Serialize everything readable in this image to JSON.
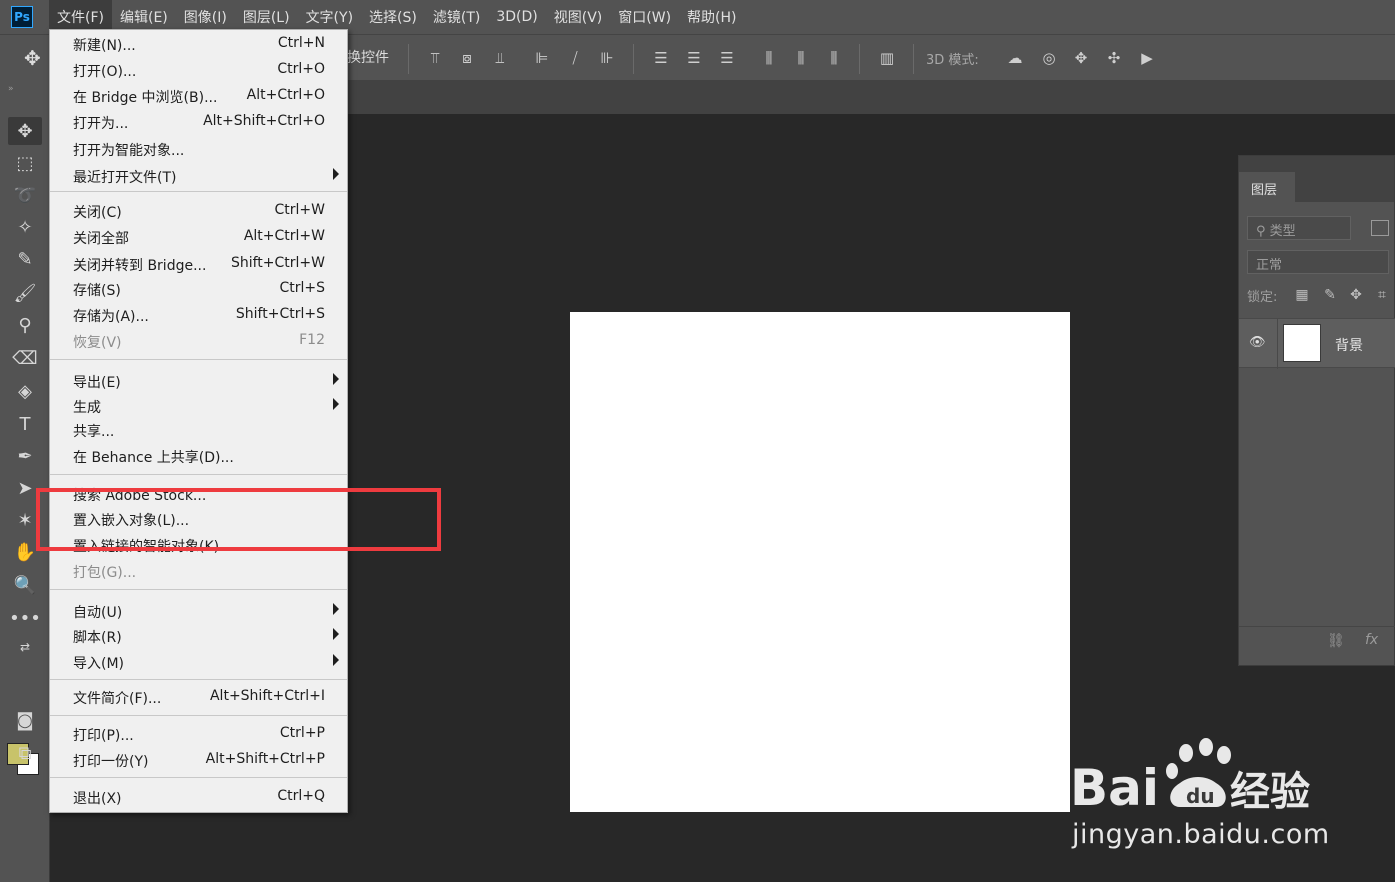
{
  "app": {
    "logo": "Ps"
  },
  "menubar": {
    "items": [
      {
        "label": "文件(F)"
      },
      {
        "label": "编辑(E)"
      },
      {
        "label": "图像(I)"
      },
      {
        "label": "图层(L)"
      },
      {
        "label": "文字(Y)"
      },
      {
        "label": "选择(S)"
      },
      {
        "label": "滤镜(T)"
      },
      {
        "label": "3D(D)"
      },
      {
        "label": "视图(V)"
      },
      {
        "label": "窗口(W)"
      },
      {
        "label": "帮助(H)"
      }
    ]
  },
  "optionsbar": {
    "label_tail": "换控件",
    "mode_3d_label": "3D 模式:"
  },
  "file_menu": {
    "items": [
      {
        "label": "新建(N)...",
        "shortcut": "Ctrl+N"
      },
      {
        "label": "打开(O)...",
        "shortcut": "Ctrl+O"
      },
      {
        "label": "在 Bridge 中浏览(B)...",
        "shortcut": "Alt+Ctrl+O"
      },
      {
        "label": "打开为...",
        "shortcut": "Alt+Shift+Ctrl+O"
      },
      {
        "label": "打开为智能对象...",
        "shortcut": ""
      },
      {
        "label": "最近打开文件(T)",
        "shortcut": ""
      },
      {
        "label": "关闭(C)",
        "shortcut": "Ctrl+W"
      },
      {
        "label": "关闭全部",
        "shortcut": "Alt+Ctrl+W"
      },
      {
        "label": "关闭并转到 Bridge...",
        "shortcut": "Shift+Ctrl+W"
      },
      {
        "label": "存储(S)",
        "shortcut": "Ctrl+S"
      },
      {
        "label": "存储为(A)...",
        "shortcut": "Shift+Ctrl+S"
      },
      {
        "label": "恢复(V)",
        "shortcut": "F12"
      },
      {
        "label": "导出(E)",
        "shortcut": ""
      },
      {
        "label": "生成",
        "shortcut": ""
      },
      {
        "label": "共享...",
        "shortcut": ""
      },
      {
        "label": "在 Behance 上共享(D)...",
        "shortcut": ""
      },
      {
        "label": "搜索 Adobe Stock...",
        "shortcut": ""
      },
      {
        "label": "置入嵌入对象(L)...",
        "shortcut": ""
      },
      {
        "label": "置入链接的智能对象(K)...",
        "shortcut": ""
      },
      {
        "label": "打包(G)...",
        "shortcut": ""
      },
      {
        "label": "自动(U)",
        "shortcut": ""
      },
      {
        "label": "脚本(R)",
        "shortcut": ""
      },
      {
        "label": "导入(M)",
        "shortcut": ""
      },
      {
        "label": "文件简介(F)...",
        "shortcut": "Alt+Shift+Ctrl+I"
      },
      {
        "label": "打印(P)...",
        "shortcut": "Ctrl+P"
      },
      {
        "label": "打印一份(Y)",
        "shortcut": "Alt+Shift+Ctrl+P"
      },
      {
        "label": "退出(X)",
        "shortcut": "Ctrl+Q"
      }
    ]
  },
  "layers_panel": {
    "tab": "图层",
    "filter_placeholder": "类型",
    "blend_mode": "正常",
    "lock_label": "锁定:",
    "layer_name": "背景",
    "footer_fx": "fx"
  },
  "watermark": {
    "logo_text": "Bai",
    "logo_suffix": "经验",
    "url": "jingyan.baidu.com"
  },
  "colors": {
    "foreground": "#c8c36a",
    "background": "#ffffff",
    "highlight": "#ee3b3f",
    "ui_panel": "#535353",
    "workspace": "#282828"
  }
}
